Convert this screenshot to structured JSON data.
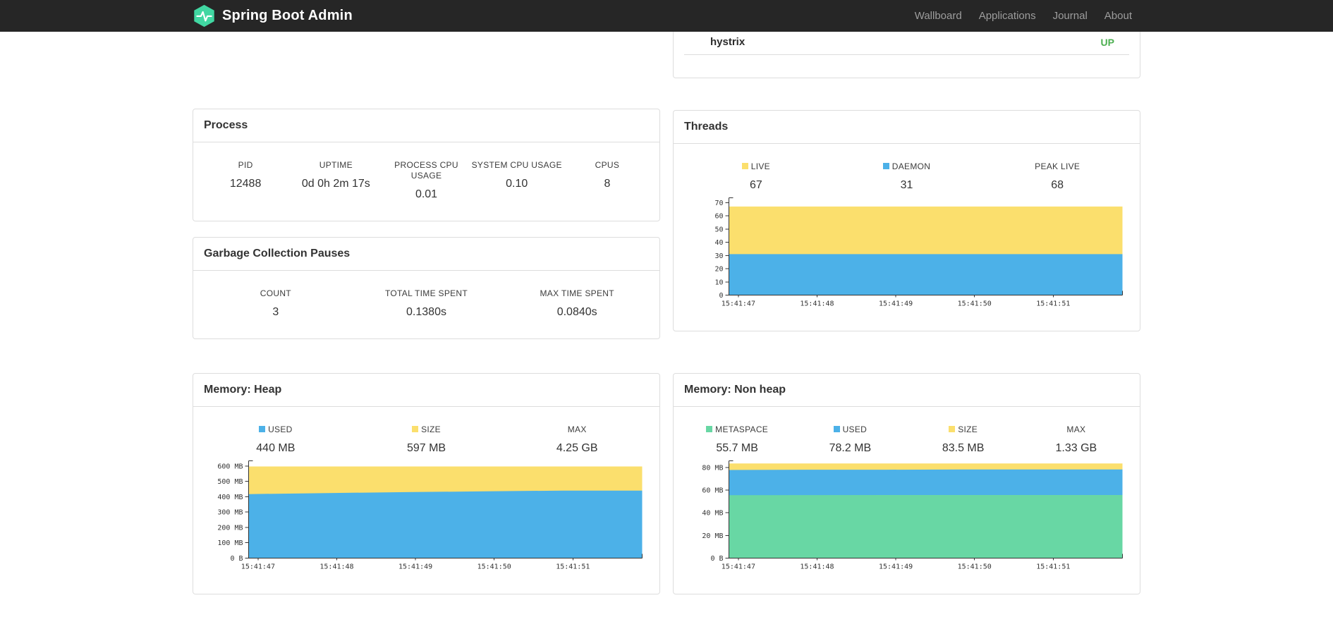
{
  "navbar": {
    "brand": "Spring Boot Admin",
    "items": [
      {
        "label": "Wallboard"
      },
      {
        "label": "Applications"
      },
      {
        "label": "Journal"
      },
      {
        "label": "About"
      }
    ]
  },
  "colors": {
    "brand": "#41d7a2",
    "status_up": "#4caf50",
    "navbar_bg": "#262626",
    "panel_border": "#dddddd",
    "blue": "#4cb1e8",
    "yellow": "#fbdf6d",
    "green": "#68d7a4"
  },
  "applications_panel": {
    "row": {
      "name": "hystrix",
      "status": "UP"
    }
  },
  "process": {
    "title": "Process",
    "stats": [
      {
        "label": "PID",
        "value": "12488"
      },
      {
        "label": "UPTIME",
        "value": "0d 0h 2m 17s"
      },
      {
        "label": "PROCESS CPU USAGE",
        "value": "0.01"
      },
      {
        "label": "SYSTEM CPU USAGE",
        "value": "0.10"
      },
      {
        "label": "CPUS",
        "value": "8"
      }
    ]
  },
  "gc": {
    "title": "Garbage Collection Pauses",
    "stats": [
      {
        "label": "COUNT",
        "value": "3"
      },
      {
        "label": "TOTAL TIME SPENT",
        "value": "0.1380s"
      },
      {
        "label": "MAX TIME SPENT",
        "value": "0.0840s"
      }
    ]
  },
  "chart_data": [
    {
      "id": "threads",
      "type": "area",
      "title": "Threads",
      "xlabel": "",
      "ylabel": "",
      "legend_position": "top",
      "grid": false,
      "legend": [
        {
          "label": "LIVE",
          "value": "67",
          "color": "#fbdf6d"
        },
        {
          "label": "DAEMON",
          "value": "31",
          "color": "#4cb1e8"
        },
        {
          "label": "PEAK LIVE",
          "value": "68",
          "color": null
        }
      ],
      "x": [
        "15:41:47",
        "15:41:48",
        "15:41:49",
        "15:41:50",
        "15:41:51"
      ],
      "series": [
        {
          "name": "LIVE",
          "color": "#fbdf6d",
          "values": [
            67,
            67,
            67,
            67,
            67,
            67
          ]
        },
        {
          "name": "DAEMON",
          "color": "#4cb1e8",
          "values": [
            31,
            31,
            31,
            31,
            31,
            31
          ]
        }
      ],
      "ylim": [
        0,
        72
      ],
      "yticks": [
        0,
        10,
        20,
        30,
        40,
        50,
        60,
        70
      ],
      "ytick_labels": [
        "0",
        "10",
        "20",
        "30",
        "40",
        "50",
        "60",
        "70"
      ]
    },
    {
      "id": "heap",
      "type": "area",
      "title": "Memory: Heap",
      "xlabel": "",
      "ylabel": "",
      "legend_position": "top",
      "grid": false,
      "legend": [
        {
          "label": "USED",
          "value": "440 MB",
          "color": "#4cb1e8"
        },
        {
          "label": "SIZE",
          "value": "597 MB",
          "color": "#fbdf6d"
        },
        {
          "label": "MAX",
          "value": "4.25 GB",
          "color": null
        }
      ],
      "x": [
        "15:41:47",
        "15:41:48",
        "15:41:49",
        "15:41:50",
        "15:41:51"
      ],
      "series": [
        {
          "name": "SIZE",
          "color": "#fbdf6d",
          "values": [
            597,
            597,
            597,
            597,
            597,
            597
          ]
        },
        {
          "name": "USED",
          "color": "#4cb1e8",
          "values": [
            417,
            424,
            430,
            435,
            440,
            440
          ]
        }
      ],
      "ylim": [
        0,
        620
      ],
      "yticks": [
        0,
        100,
        200,
        300,
        400,
        500,
        600
      ],
      "ytick_labels": [
        "0 B",
        "100 MB",
        "200 MB",
        "300 MB",
        "400 MB",
        "500 MB",
        "600 MB"
      ]
    },
    {
      "id": "nonheap",
      "type": "area",
      "title": "Memory: Non heap",
      "xlabel": "",
      "ylabel": "",
      "legend_position": "top",
      "grid": false,
      "legend": [
        {
          "label": "METASPACE",
          "value": "55.7 MB",
          "color": "#68d7a4"
        },
        {
          "label": "USED",
          "value": "78.2 MB",
          "color": "#4cb1e8"
        },
        {
          "label": "SIZE",
          "value": "83.5 MB",
          "color": "#fbdf6d"
        },
        {
          "label": "MAX",
          "value": "1.33 GB",
          "color": null
        }
      ],
      "x": [
        "15:41:47",
        "15:41:48",
        "15:41:49",
        "15:41:50",
        "15:41:51"
      ],
      "series": [
        {
          "name": "SIZE",
          "color": "#fbdf6d",
          "values": [
            83.5,
            83.5,
            83.5,
            83.5,
            83.5,
            83.5
          ]
        },
        {
          "name": "USED",
          "color": "#4cb1e8",
          "values": [
            77.8,
            78,
            78,
            78.2,
            78.2,
            78.2
          ]
        },
        {
          "name": "METASPACE",
          "color": "#68d7a4",
          "values": [
            55.5,
            55.6,
            55.7,
            55.7,
            55.7,
            55.7
          ]
        }
      ],
      "ylim": [
        0,
        84
      ],
      "yticks": [
        0,
        20,
        40,
        60,
        80
      ],
      "ytick_labels": [
        "0 B",
        "20 MB",
        "40 MB",
        "60 MB",
        "80 MB"
      ]
    }
  ]
}
